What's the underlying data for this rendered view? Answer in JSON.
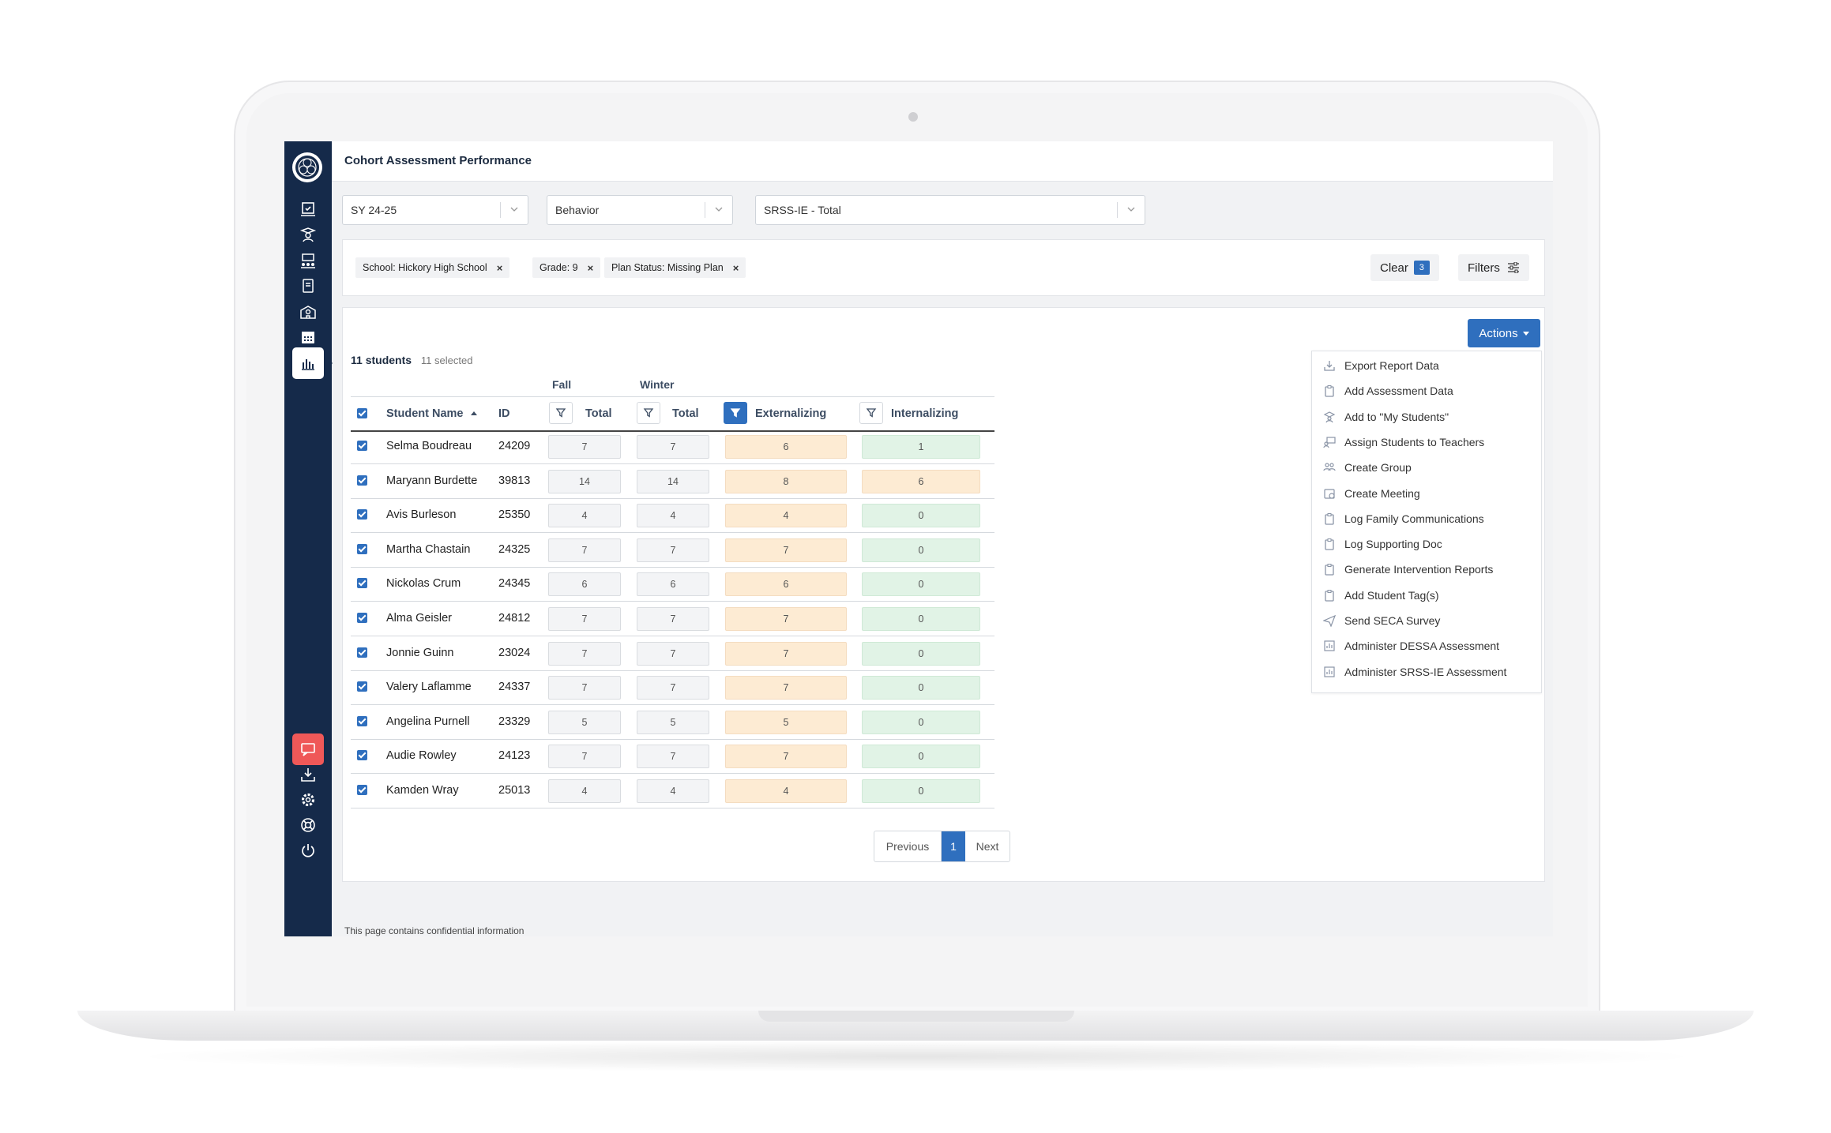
{
  "app": {
    "title": "Cohort Assessment Performance",
    "confidential_note": "This page contains confidential information"
  },
  "sidebar": {
    "items": [
      {
        "icon": "assessment-icon"
      },
      {
        "icon": "graduate-icon"
      },
      {
        "icon": "classroom-icon"
      },
      {
        "icon": "book-icon"
      },
      {
        "icon": "school-icon"
      },
      {
        "icon": "calendar-icon"
      },
      {
        "icon": "bar-chart-icon",
        "active": true
      }
    ],
    "bottom_items": [
      {
        "icon": "chat-icon"
      },
      {
        "icon": "download-icon"
      },
      {
        "icon": "gear-icon"
      },
      {
        "icon": "help-icon"
      },
      {
        "icon": "power-icon"
      }
    ]
  },
  "selects": {
    "year": "SY 24-25",
    "category": "Behavior",
    "assessment": "SRSS-IE - Total"
  },
  "filters": {
    "chips": [
      "School: Hickory High School",
      "Grade: 9",
      "Plan Status: Missing Plan"
    ],
    "chip_close": "×",
    "clear_label": "Clear",
    "clear_count": "3",
    "filters_label": "Filters"
  },
  "table": {
    "student_count": "11 students",
    "selected_count": "11 selected",
    "group_headers": {
      "fall": "Fall",
      "winter": "Winter"
    },
    "columns": {
      "name": "Student Name",
      "id": "ID",
      "fall_total": "Total",
      "winter_total": "Total",
      "externalizing": "Externalizing",
      "internalizing": "Internalizing"
    },
    "rows": [
      {
        "name": "Selma Boudreau",
        "id": "24209",
        "fall": "7",
        "winter": "7",
        "ext": "6",
        "int": "1",
        "ext_color": "orange",
        "int_color": "green"
      },
      {
        "name": "Maryann Burdette",
        "id": "39813",
        "fall": "14",
        "winter": "14",
        "ext": "8",
        "int": "6",
        "ext_color": "orange",
        "int_color": "orange"
      },
      {
        "name": "Avis Burleson",
        "id": "25350",
        "fall": "4",
        "winter": "4",
        "ext": "4",
        "int": "0",
        "ext_color": "orange",
        "int_color": "green"
      },
      {
        "name": "Martha Chastain",
        "id": "24325",
        "fall": "7",
        "winter": "7",
        "ext": "7",
        "int": "0",
        "ext_color": "orange",
        "int_color": "green"
      },
      {
        "name": "Nickolas Crum",
        "id": "24345",
        "fall": "6",
        "winter": "6",
        "ext": "6",
        "int": "0",
        "ext_color": "orange",
        "int_color": "green"
      },
      {
        "name": "Alma Geisler",
        "id": "24812",
        "fall": "7",
        "winter": "7",
        "ext": "7",
        "int": "0",
        "ext_color": "orange",
        "int_color": "green"
      },
      {
        "name": "Jonnie Guinn",
        "id": "23024",
        "fall": "7",
        "winter": "7",
        "ext": "7",
        "int": "0",
        "ext_color": "orange",
        "int_color": "green"
      },
      {
        "name": "Valery Laflamme",
        "id": "24337",
        "fall": "7",
        "winter": "7",
        "ext": "7",
        "int": "0",
        "ext_color": "orange",
        "int_color": "green"
      },
      {
        "name": "Angelina Purnell",
        "id": "23329",
        "fall": "5",
        "winter": "5",
        "ext": "5",
        "int": "0",
        "ext_color": "orange",
        "int_color": "green"
      },
      {
        "name": "Audie Rowley",
        "id": "24123",
        "fall": "7",
        "winter": "7",
        "ext": "7",
        "int": "0",
        "ext_color": "orange",
        "int_color": "green"
      },
      {
        "name": "Kamden Wray",
        "id": "25013",
        "fall": "4",
        "winter": "4",
        "ext": "4",
        "int": "0",
        "ext_color": "orange",
        "int_color": "green"
      }
    ]
  },
  "pagination": {
    "previous": "Previous",
    "page": "1",
    "next": "Next"
  },
  "actions": {
    "label": "Actions",
    "items": [
      {
        "label": "Export Report Data",
        "icon": "export-icon"
      },
      {
        "label": "Add Assessment Data",
        "icon": "clipboard-icon"
      },
      {
        "label": "Add to \"My Students\"",
        "icon": "graduate-icon"
      },
      {
        "label": "Assign Students to Teachers",
        "icon": "teacher-icon"
      },
      {
        "label": "Create Group",
        "icon": "group-icon"
      },
      {
        "label": "Create Meeting",
        "icon": "meeting-icon"
      },
      {
        "label": "Log Family Communications",
        "icon": "clipboard-icon"
      },
      {
        "label": "Log Supporting Doc",
        "icon": "clipboard-icon"
      },
      {
        "label": "Generate Intervention Reports",
        "icon": "clipboard-icon"
      },
      {
        "label": "Add Student Tag(s)",
        "icon": "clipboard-icon"
      },
      {
        "label": "Send SECA Survey",
        "icon": "send-icon"
      },
      {
        "label": "Administer DESSA Assessment",
        "icon": "chart-icon"
      },
      {
        "label": "Administer SRSS-IE Assessment",
        "icon": "chart-icon"
      }
    ]
  },
  "colors": {
    "sidebar": "#152a4a",
    "accent": "#2f6fbe",
    "chat": "#ef5858",
    "cell_orange": "#fdebd3",
    "cell_green": "#e1f3e6",
    "cell_grey": "#f3f4f6"
  }
}
